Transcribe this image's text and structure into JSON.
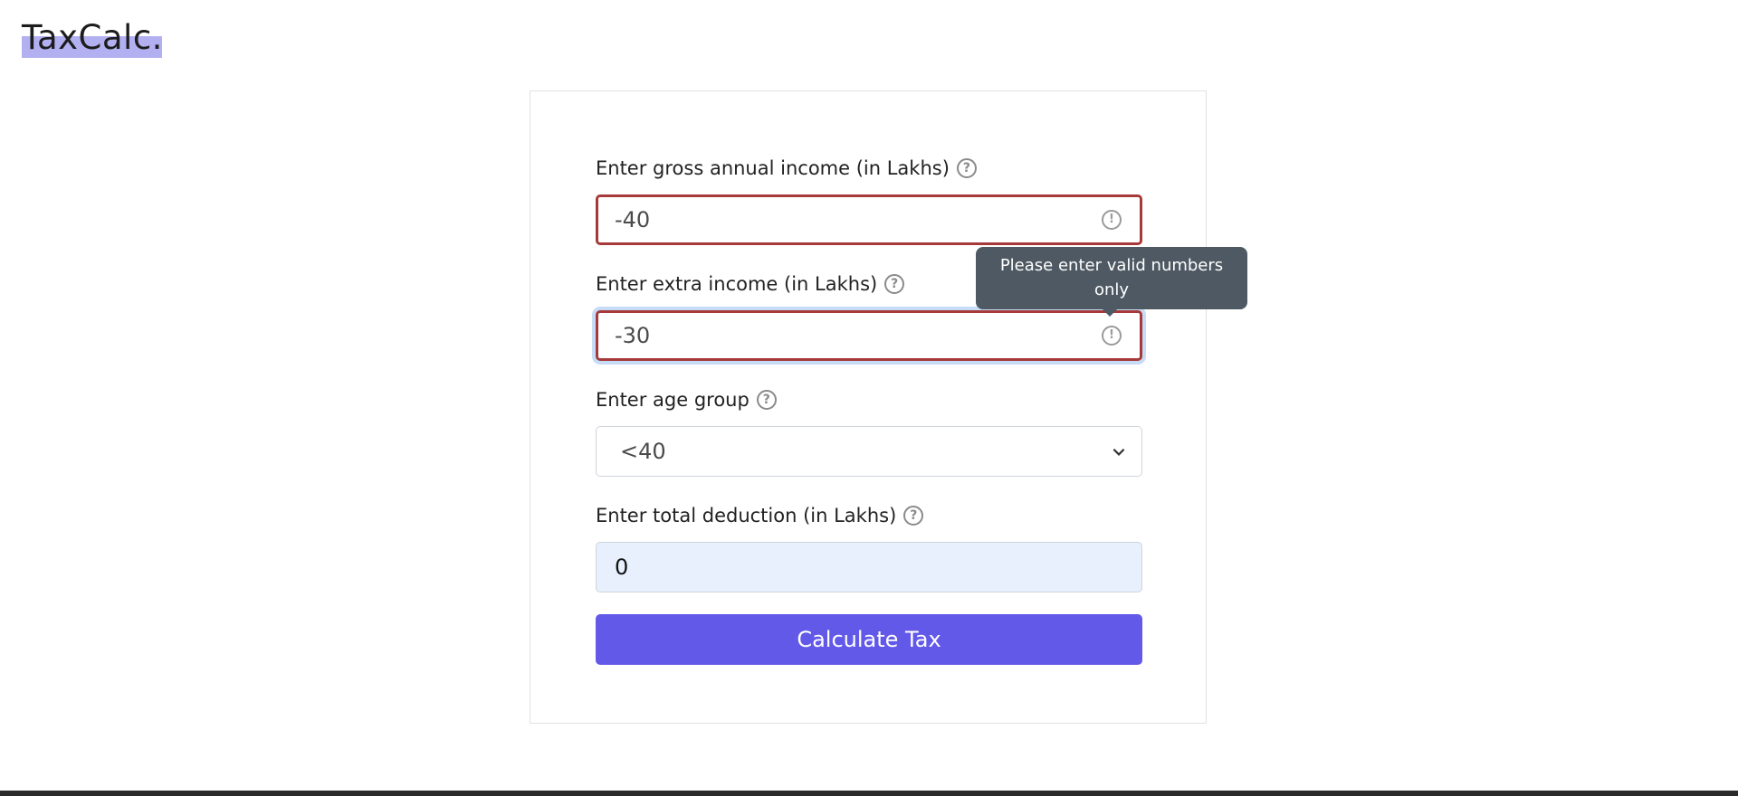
{
  "brand": {
    "logo_text": "TaxCalc."
  },
  "form": {
    "gross_income": {
      "label": "Enter gross annual income (in Lakhs)",
      "value": "-40",
      "help": "?"
    },
    "extra_income": {
      "label": "Enter extra income (in Lakhs)",
      "value": "-30",
      "help": "?"
    },
    "age_group": {
      "label": "Enter age group",
      "selected": "<40",
      "help": "?"
    },
    "deduction": {
      "label": "Enter total deduction (in Lakhs)",
      "value": "0",
      "help": "?"
    },
    "error_icon": "!",
    "submit_label": "Calculate Tax"
  },
  "tooltip": {
    "text": "Please enter valid numbers only"
  },
  "icons": [
    "help-icon",
    "error-icon",
    "chevron-down-icon"
  ],
  "colors": {
    "accent": "#6359e9",
    "error": "#a63a3a",
    "logo_highlight": "#b3b0f2",
    "tooltip_bg": "#4e5963",
    "autofill_bg": "#e8f0fd"
  }
}
